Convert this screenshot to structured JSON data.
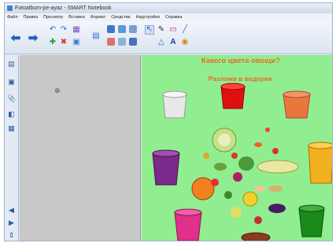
{
  "window": {
    "title": "Fotoalbum-pe-ayaz - SMART Notebook"
  },
  "menu": {
    "items": [
      "Файл",
      "Правка",
      "Просмотр",
      "Вставка",
      "Формат",
      "Средства",
      "Надстройки",
      "Справка"
    ]
  },
  "toolbar": {
    "buttons": [
      {
        "name": "back-button",
        "glyph": "⬅"
      },
      {
        "name": "forward-button",
        "glyph": "➡"
      },
      {
        "name": "undo-button",
        "glyph": "↶"
      },
      {
        "name": "redo-button",
        "glyph": "↷"
      },
      {
        "name": "add-page-button",
        "glyph": "✚"
      },
      {
        "name": "delete-button",
        "glyph": "✖"
      },
      {
        "name": "screen-shade-button",
        "glyph": "▦"
      },
      {
        "name": "capture-button",
        "glyph": "▣"
      },
      {
        "name": "table-button",
        "glyph": "▤"
      },
      {
        "name": "select-button",
        "glyph": "↖"
      },
      {
        "name": "pen-button",
        "glyph": "✎"
      },
      {
        "name": "eraser-button",
        "glyph": "▭"
      },
      {
        "name": "line-button",
        "glyph": "╱"
      },
      {
        "name": "shapes-button",
        "glyph": "△"
      },
      {
        "name": "text-button",
        "glyph": "A"
      },
      {
        "name": "fill-button",
        "glyph": "◉"
      }
    ]
  },
  "sidebar": {
    "icons": [
      "page-sorter-icon",
      "gallery-icon",
      "attachments-icon",
      "properties-icon",
      "addons-icon",
      "arrow-left-icon",
      "arrow-right-icon",
      "pin-icon"
    ]
  },
  "slide": {
    "title": "Какого цвета овощи?",
    "subtitle": "Разложи в ведерки",
    "colors": {
      "background": "#90ee90",
      "text": "#e86a2a"
    }
  }
}
